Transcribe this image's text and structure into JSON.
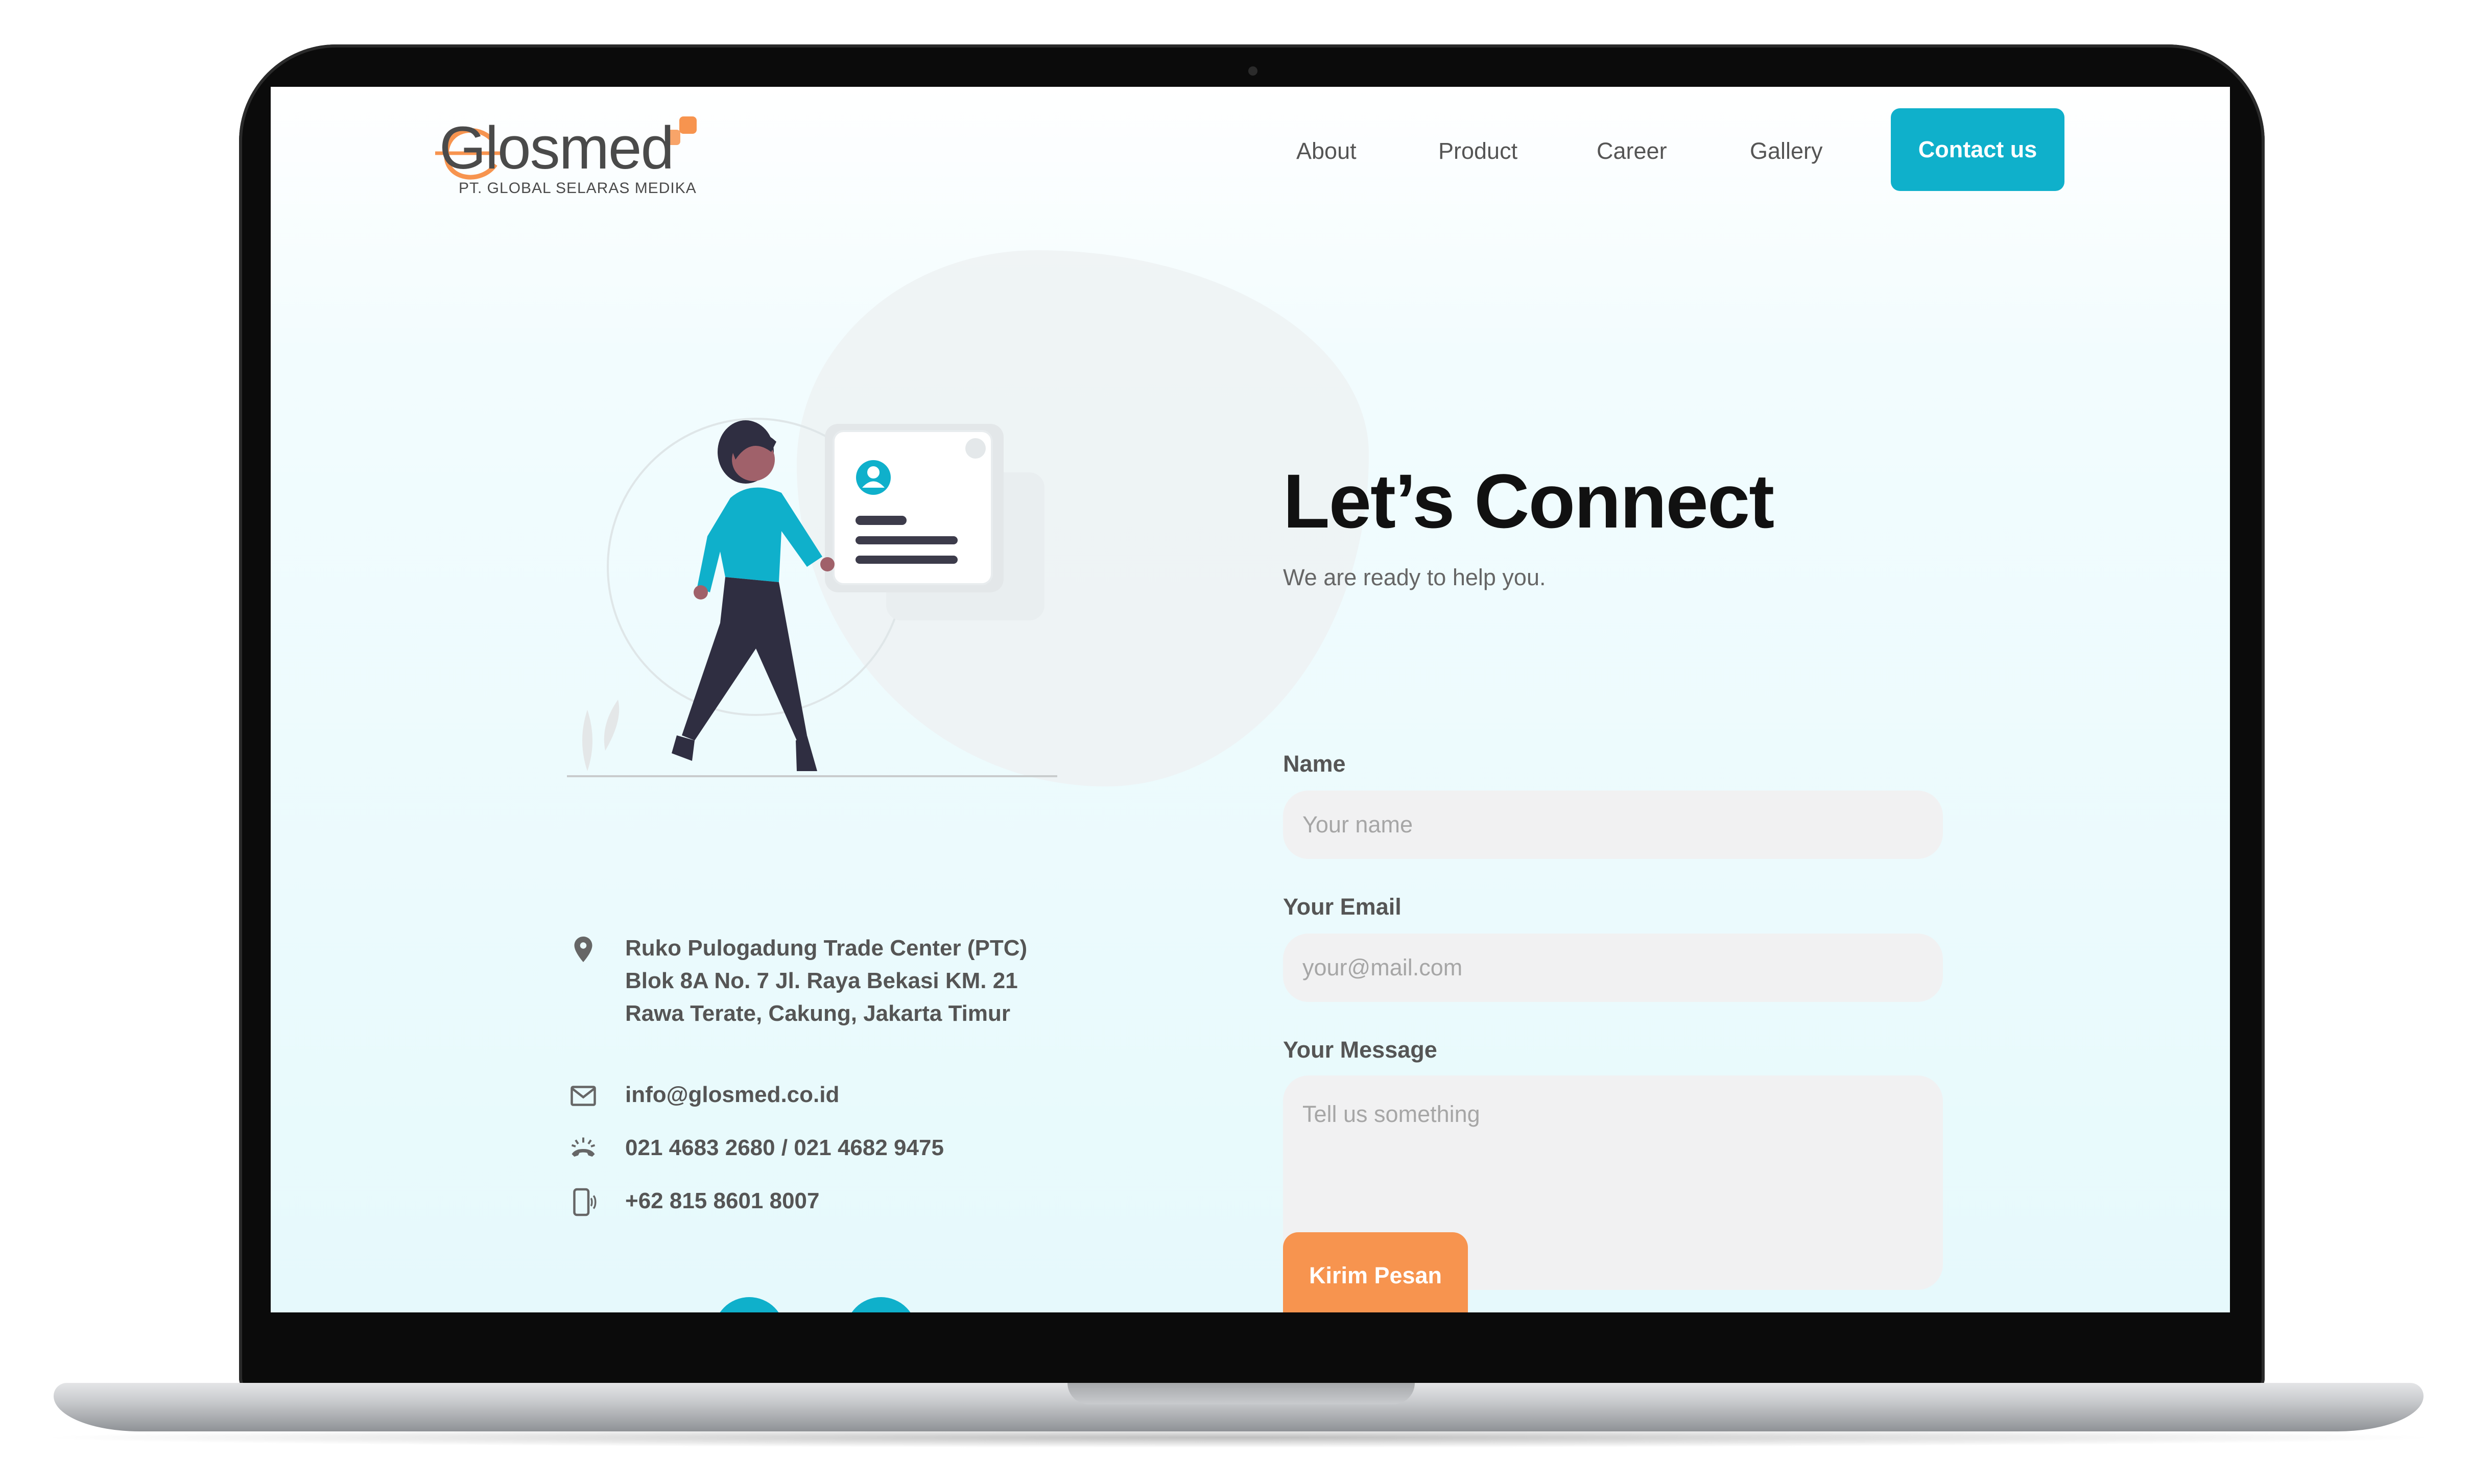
{
  "brand": {
    "name": "Glosmed",
    "tagline": "PT. GLOBAL SELARAS MEDIKA",
    "primary_color": "#0fb0cb",
    "accent_color": "#f7944f"
  },
  "nav": {
    "links": [
      "About",
      "Product",
      "Career",
      "Gallery"
    ],
    "cta_label": "Contact us"
  },
  "contact_info": {
    "address_lines": [
      "Ruko Pulogadung Trade Center (PTC)",
      "Blok 8A No. 7 Jl. Raya Bekasi KM. 21",
      "Rawa Terate, Cakung, Jakarta Timur"
    ],
    "email": "info@glosmed.co.id",
    "phone": "021 4683 2680 / 021 4682 9475",
    "mobile": "+62 815 8601 8007",
    "icons": [
      "location-pin-icon",
      "mail-icon",
      "phone-icon",
      "mobile-icon"
    ]
  },
  "form": {
    "heading": "Let’s Connect",
    "subheading": "We are ready to help you.",
    "name_label": "Name",
    "name_placeholder": "Your name",
    "email_label": "Your Email",
    "email_placeholder": "your@mail.com",
    "message_label": "Your Message",
    "message_placeholder": "Tell us something",
    "submit_label": "Kirim Pesan"
  }
}
